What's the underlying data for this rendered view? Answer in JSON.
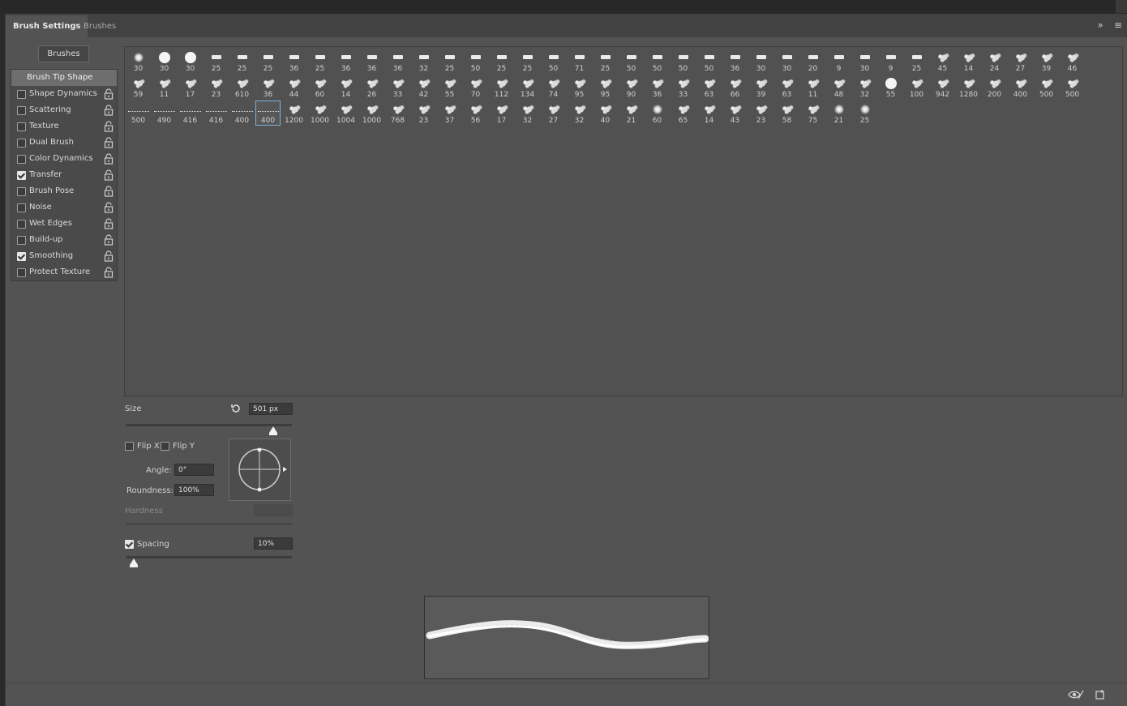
{
  "tabs": [
    {
      "label": "Brush Settings",
      "active": true
    },
    {
      "label": "Brushes",
      "active": false
    }
  ],
  "tabbar_icons": [
    "expand-icon",
    "panel-menu-icon"
  ],
  "brushes_button": "Brushes",
  "left_list": {
    "header": "Brush Tip Shape",
    "items": [
      {
        "label": "Shape Dynamics",
        "checked": false
      },
      {
        "label": "Scattering",
        "checked": false
      },
      {
        "label": "Texture",
        "checked": false
      },
      {
        "label": "Dual Brush",
        "checked": false
      },
      {
        "label": "Color Dynamics",
        "checked": false
      },
      {
        "label": "Transfer",
        "checked": true
      },
      {
        "label": "Brush Pose",
        "checked": false
      },
      {
        "label": "Noise",
        "checked": false
      },
      {
        "label": "Wet Edges",
        "checked": false
      },
      {
        "label": "Build-up",
        "checked": false
      },
      {
        "label": "Smoothing",
        "checked": true
      },
      {
        "label": "Protect Texture",
        "checked": false
      }
    ]
  },
  "brush_rows": [
    [
      "30",
      "30",
      "30",
      "25",
      "25",
      "25",
      "36",
      "25",
      "36",
      "36",
      "36",
      "32",
      "25",
      "50",
      "25",
      "25",
      "50",
      "71",
      "25",
      "50",
      "50",
      "50",
      "50",
      "36",
      "30",
      "30",
      "20",
      "9",
      "30",
      "9",
      "25",
      "45",
      "14",
      "24",
      "27",
      "39",
      "46"
    ],
    [
      "59",
      "11",
      "17",
      "23",
      "610",
      "36",
      "44",
      "60",
      "14",
      "26",
      "33",
      "42",
      "55",
      "70",
      "112",
      "134",
      "74",
      "95",
      "95",
      "90",
      "36",
      "33",
      "63",
      "66",
      "39",
      "63",
      "11",
      "48",
      "32",
      "55",
      "100",
      "942",
      "1280",
      "200",
      "400",
      "500",
      "500"
    ],
    [
      "500",
      "490",
      "416",
      "416",
      "400",
      "400",
      "1200",
      "1000",
      "1004",
      "1000",
      "768",
      "23",
      "37",
      "56",
      "17",
      "32",
      "27",
      "32",
      "40",
      "21",
      "60",
      "65",
      "14",
      "43",
      "23",
      "58",
      "75",
      "21",
      "25"
    ]
  ],
  "selected_brush": {
    "row": 2,
    "col": 5
  },
  "size": {
    "label": "Size",
    "value": "501 px",
    "fraction": 0.89
  },
  "flip_x": {
    "label": "Flip X",
    "checked": false
  },
  "flip_y": {
    "label": "Flip Y",
    "checked": false
  },
  "angle": {
    "label": "Angle:",
    "value": "0°"
  },
  "roundness": {
    "label": "Roundness:",
    "value": "100%"
  },
  "hardness": {
    "label": "Hardness",
    "value": ""
  },
  "spacing": {
    "label": "Spacing",
    "value": "10%",
    "checked": true,
    "fraction": 0.05
  },
  "status_icons": [
    "visibility-icon",
    "new-preset-icon"
  ],
  "colors": {
    "panel": "#535353",
    "selection": "#7fb0d8",
    "header": "#6e6e6e"
  }
}
